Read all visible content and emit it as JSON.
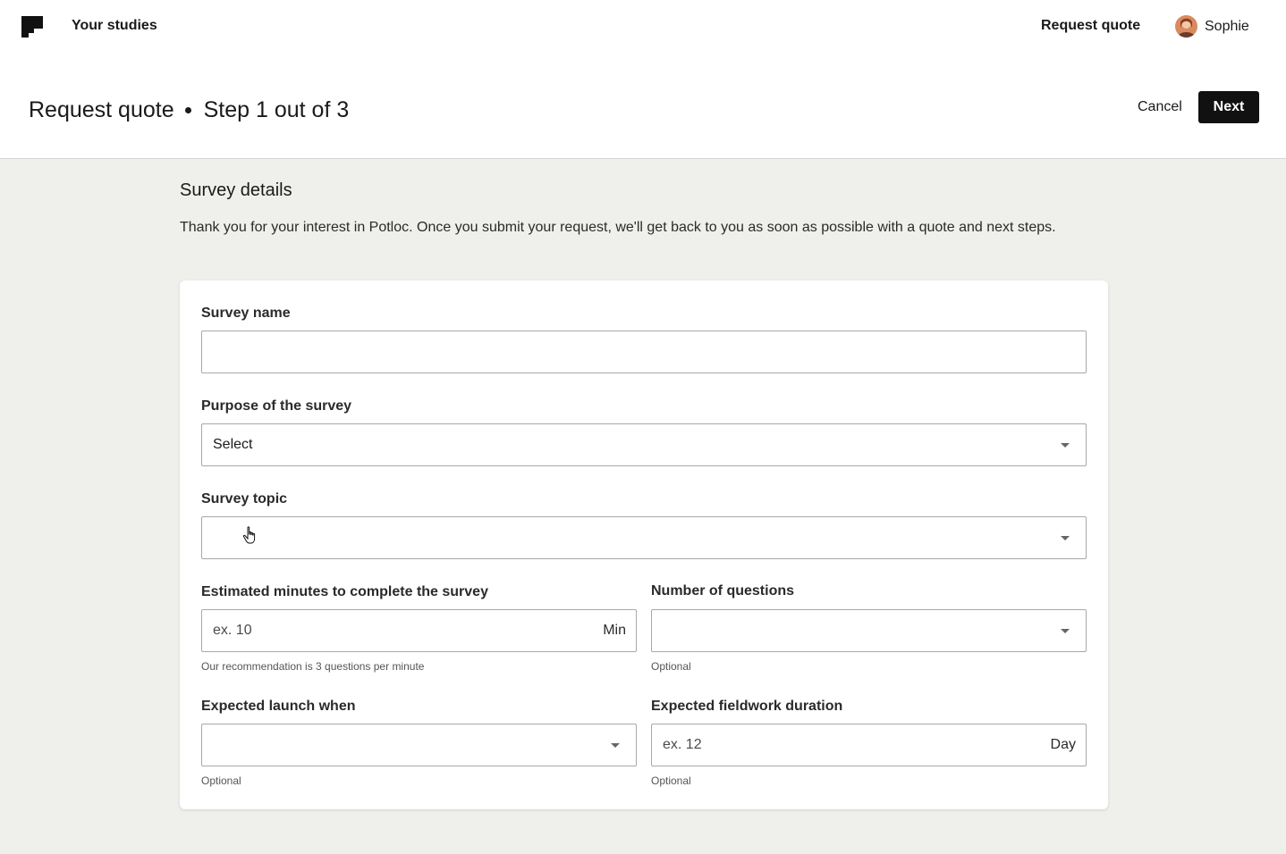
{
  "header": {
    "nav_studies": "Your studies",
    "nav_request_quote": "Request quote",
    "user_name": "Sophie",
    "logo_icon": "brand-logo-icon",
    "avatar_icon": "user-avatar"
  },
  "page": {
    "title": "Request quote",
    "step": "Step 1 out of 3",
    "cancel_label": "Cancel",
    "next_label": "Next"
  },
  "section": {
    "title": "Survey details",
    "intro": "Thank you for your interest in Potloc. Once you submit your request, we'll get back to you as soon as possible with a quote and next steps."
  },
  "form": {
    "survey_name": {
      "label": "Survey name",
      "value": ""
    },
    "purpose": {
      "label": "Purpose of the survey",
      "value": "Select"
    },
    "topic": {
      "label": "Survey topic",
      "value": ""
    },
    "minutes": {
      "label": "Estimated minutes to complete the survey",
      "placeholder": "ex. 10",
      "suffix": "Min",
      "help": "Our recommendation is 3 questions per minute"
    },
    "questions": {
      "label": "Number of questions",
      "value": "",
      "help": "Optional"
    },
    "launch": {
      "label": "Expected launch when",
      "value": "",
      "help": "Optional"
    },
    "duration": {
      "label": "Expected fieldwork duration",
      "placeholder": "ex. 12",
      "suffix": "Day",
      "help": "Optional"
    }
  },
  "colors": {
    "background": "#efefec",
    "surface": "#ffffff",
    "primary_button": "#111111",
    "border": "#a8a8a8"
  }
}
